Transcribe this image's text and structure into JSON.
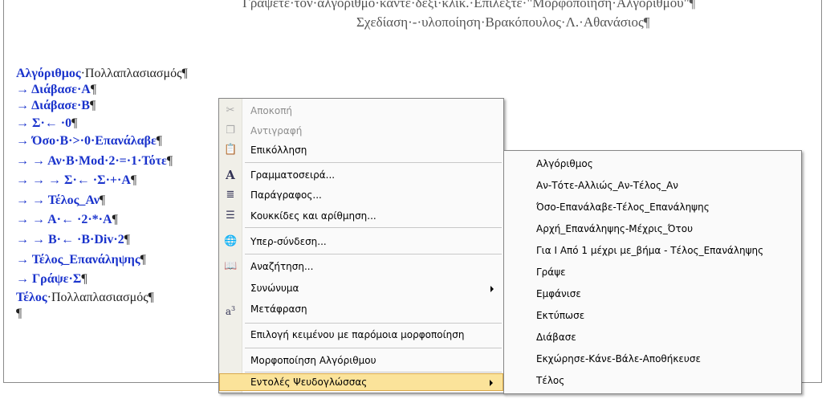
{
  "header": {
    "line1": "Γράψετε·τον·αλγόριθμο·κάντε·δεξί·κλικ.·Επιλέξτε·\"Μορφοποίηση·Αλγορίθμου\"¶",
    "line2": "Σχεδίαση·-·υλοποίηση·Βρακόπουλος·Λ.·Αθανάσιος¶"
  },
  "document": {
    "l1_kw": "Αλγόριθμος",
    "l1_rest": "·Πολλαπλασιασμός¶",
    "l2": "→ Διάβασε·Α",
    "l2_end": "¶",
    "l3": "→ Διάβασε·Β",
    "l3_end": "¶",
    "l4": "→ Σ·← ·0",
    "l4_end": "¶",
    "l5": "→ Όσο·Β·>·0·Επανάλαβε",
    "l5_end": "¶",
    "l6": "→ → Αν·Β·Mod·2·=·1·Τότε",
    "l6_end": "¶",
    "l7": "→ → → Σ·← ·Σ·+·Α",
    "l7_end": "¶",
    "l8": "→ → Τέλος_Αν",
    "l8_end": "¶",
    "l9": "→ → Α·← ·2·*·Α",
    "l9_end": "¶",
    "l10": "→ → Β·← ·Β·Div·2",
    "l10_end": "¶",
    "l11": "→ Τέλος_Επανάληψης",
    "l11_end": "¶",
    "l12": "→ Γράψε·Σ",
    "l12_end": "¶",
    "l13_kw": "Τέλος",
    "l13_rest": "·Πολλαπλασιασμός¶",
    "l14": "¶"
  },
  "context_menu": {
    "items": [
      {
        "label": "Αποκοπή",
        "icon": "scissors-icon",
        "glyph": "✂"
      },
      {
        "label": "Αντιγραφή",
        "icon": "copy-icon",
        "glyph": "❐"
      },
      {
        "label": "Επικόλληση",
        "icon": "paste-icon",
        "glyph": "📋"
      },
      {
        "label": "Γραμματοσειρά...",
        "icon": "font-icon",
        "glyph": "A"
      },
      {
        "label": "Παράγραφος...",
        "icon": "paragraph-icon",
        "glyph": "≣"
      },
      {
        "label": "Κουκκίδες και αρίθμηση...",
        "icon": "bullets-icon",
        "glyph": "☰"
      },
      {
        "label": "Υπερ-σύνδεση...",
        "icon": "hyperlink-icon",
        "glyph": "🌐"
      },
      {
        "label": "Αναζήτηση...",
        "icon": "research-icon",
        "glyph": "📖"
      },
      {
        "label": "Συνώνυμα",
        "icon": "",
        "glyph": ""
      },
      {
        "label": "Μετάφραση",
        "icon": "translate-icon",
        "glyph": "a"
      },
      {
        "label": "Επιλογή κειμένου με παρόμοια μορφοποίηση",
        "icon": "",
        "glyph": ""
      },
      {
        "label": "Μορφοποίηση Αλγόριθμου",
        "icon": "",
        "glyph": ""
      },
      {
        "label": "Εντολές Ψευδογλώσσας",
        "icon": "",
        "glyph": ""
      }
    ]
  },
  "sub_menu": {
    "items": [
      "Αλγόριθμος",
      "Αν-Τότε-Αλλιώς_Αν-Τέλος_Αν",
      "Όσο-Επανάλαβε-Τέλος_Επανάληψης",
      "Αρχή_Επανάληψης-Μέχρις_Ότου",
      "Για Ι Από 1 μέχρι  με_βήμα - Τέλος_Επανάληψης",
      "Γράψε",
      "Εμφάνισε",
      "Εκτύπωσε",
      "Διάβασε",
      "Εκχώρησε-Κάνε-Βάλε-Αποθήκευσε",
      "Τέλος"
    ]
  },
  "colors": {
    "keyword": "#1a33cc",
    "menu_highlight": "#fbe39a"
  }
}
